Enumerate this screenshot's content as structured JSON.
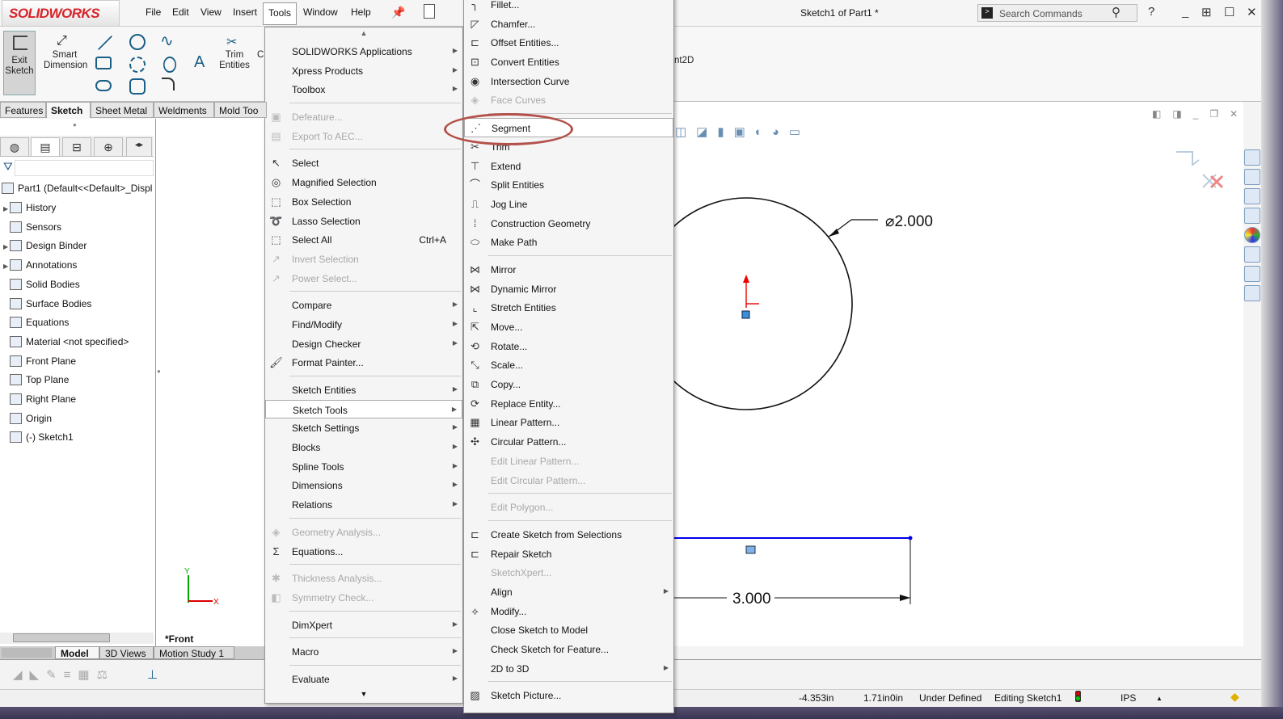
{
  "app": {
    "brand": "SOLIDWORKS",
    "doc_title": "Sketch1 of Part1 *",
    "search_placeholder": "Search Commands"
  },
  "menubar": [
    "File",
    "Edit",
    "View",
    "Insert",
    "Tools",
    "Window",
    "Help"
  ],
  "ribbon": {
    "exit_sketch": "Exit Sketch",
    "smart_dimension": "Smart Dimension",
    "trim_entities": "Trim Entities",
    "partial_c": "C",
    "partial_e": "E",
    "partial_nt2d": "nt2D"
  },
  "command_tabs": [
    "Features",
    "Sketch",
    "Sheet Metal",
    "Weldments",
    "Mold Too"
  ],
  "tree": {
    "root": "Part1  (Default<<Default>_Displ",
    "items": [
      {
        "label": "History",
        "exp": true
      },
      {
        "label": "Sensors",
        "exp": false
      },
      {
        "label": "Design Binder",
        "exp": true
      },
      {
        "label": "Annotations",
        "exp": true
      },
      {
        "label": "Solid Bodies",
        "exp": false
      },
      {
        "label": "Surface Bodies",
        "exp": false
      },
      {
        "label": "Equations",
        "exp": false
      },
      {
        "label": "Material <not specified>",
        "exp": false
      },
      {
        "label": "Front Plane",
        "exp": false
      },
      {
        "label": "Top Plane",
        "exp": false
      },
      {
        "label": "Right Plane",
        "exp": false
      },
      {
        "label": "Origin",
        "exp": false
      },
      {
        "label": "(-) Sketch1",
        "exp": false
      }
    ]
  },
  "bottom_tabs": [
    "Model",
    "3D Views",
    "Motion Study 1"
  ],
  "view_label": "*Front",
  "triad": {
    "x": "X",
    "y": "Y"
  },
  "sketch": {
    "circle_dim": "⌀2.000",
    "line_dim": "3.000"
  },
  "tools_menu": [
    {
      "label": "SOLIDWORKS Applications",
      "sub": true
    },
    {
      "label": "Xpress Products",
      "sub": true
    },
    {
      "label": "Toolbox",
      "sub": true
    },
    {
      "sep": true
    },
    {
      "label": "Defeature...",
      "dis": true,
      "icon": "▣"
    },
    {
      "label": "Export To AEC...",
      "dis": true,
      "icon": "▤"
    },
    {
      "sep": true
    },
    {
      "label": "Select",
      "icon": "↖"
    },
    {
      "label": "Magnified Selection",
      "icon": "◎"
    },
    {
      "label": "Box Selection",
      "icon": "⬚"
    },
    {
      "label": "Lasso Selection",
      "icon": "➰"
    },
    {
      "label": "Select All",
      "shortcut": "Ctrl+A",
      "icon": "⬚"
    },
    {
      "label": "Invert Selection",
      "dis": true,
      "icon": "↗"
    },
    {
      "label": "Power Select...",
      "dis": true,
      "icon": "↗"
    },
    {
      "sep": true
    },
    {
      "label": "Compare",
      "sub": true
    },
    {
      "label": "Find/Modify",
      "sub": true
    },
    {
      "label": "Design Checker",
      "sub": true
    },
    {
      "label": "Format Painter...",
      "icon": "🖌"
    },
    {
      "sep": true
    },
    {
      "label": "Sketch Entities",
      "sub": true
    },
    {
      "label": "Sketch Tools",
      "sub": true,
      "hl": true
    },
    {
      "label": "Sketch Settings",
      "sub": true
    },
    {
      "label": "Blocks",
      "sub": true
    },
    {
      "label": "Spline Tools",
      "sub": true
    },
    {
      "label": "Dimensions",
      "sub": true
    },
    {
      "label": "Relations",
      "sub": true
    },
    {
      "sep": true
    },
    {
      "label": "Geometry Analysis...",
      "dis": true,
      "icon": "◈"
    },
    {
      "label": "Equations...",
      "icon": "Σ"
    },
    {
      "sep": true
    },
    {
      "label": "Thickness Analysis...",
      "dis": true,
      "icon": "✱"
    },
    {
      "label": "Symmetry Check...",
      "dis": true,
      "icon": "◧"
    },
    {
      "sep": true
    },
    {
      "label": "DimXpert",
      "sub": true
    },
    {
      "sep": true
    },
    {
      "label": "Macro",
      "sub": true
    },
    {
      "sep": true
    },
    {
      "label": "Evaluate",
      "sub": true
    }
  ],
  "sketch_tools_menu": [
    {
      "label": "Fillet...",
      "icon": "╮"
    },
    {
      "label": "Chamfer...",
      "icon": "◸"
    },
    {
      "label": "Offset Entities...",
      "icon": "⊏"
    },
    {
      "label": "Convert Entities",
      "icon": "⊡"
    },
    {
      "label": "Intersection Curve",
      "icon": "◉"
    },
    {
      "label": "Face Curves",
      "dis": true,
      "icon": "◈"
    },
    {
      "sep": true
    },
    {
      "label": "Segment",
      "hl": true,
      "icon": "⋰"
    },
    {
      "label": "Trim",
      "icon": "✂"
    },
    {
      "label": "Extend",
      "icon": "⊤"
    },
    {
      "label": "Split Entities",
      "icon": "⌒"
    },
    {
      "label": "Jog Line",
      "icon": "⎍"
    },
    {
      "label": "Construction Geometry",
      "icon": "⁞"
    },
    {
      "label": "Make Path",
      "icon": "⬭"
    },
    {
      "sep": true
    },
    {
      "label": "Mirror",
      "icon": "⋈"
    },
    {
      "label": "Dynamic Mirror",
      "icon": "⋈"
    },
    {
      "label": "Stretch Entities",
      "icon": "⌞"
    },
    {
      "label": "Move...",
      "icon": "⇱"
    },
    {
      "label": "Rotate...",
      "icon": "⟲"
    },
    {
      "label": "Scale...",
      "icon": "⤡"
    },
    {
      "label": "Copy...",
      "icon": "⧉"
    },
    {
      "label": "Replace Entity...",
      "icon": "⟳"
    },
    {
      "label": "Linear Pattern...",
      "icon": "▦"
    },
    {
      "label": "Circular Pattern...",
      "icon": "✣"
    },
    {
      "label": "Edit Linear Pattern...",
      "dis": true
    },
    {
      "label": "Edit Circular Pattern...",
      "dis": true
    },
    {
      "sep": true
    },
    {
      "label": "Edit Polygon...",
      "dis": true
    },
    {
      "sep": true
    },
    {
      "label": "Create Sketch from Selections",
      "icon": "⊏"
    },
    {
      "label": "Repair Sketch",
      "icon": "⊏"
    },
    {
      "label": "SketchXpert...",
      "dis": true
    },
    {
      "label": "Align",
      "sub": true
    },
    {
      "label": "Modify...",
      "icon": "⟡"
    },
    {
      "label": "Close Sketch to Model"
    },
    {
      "label": "Check Sketch for Feature..."
    },
    {
      "label": "2D to 3D",
      "sub": true
    },
    {
      "sep": true
    },
    {
      "label": "Sketch Picture...",
      "icon": "▨"
    }
  ],
  "status": {
    "x": "-4.353in",
    "y": "1.71in",
    "z": "0in",
    "state": "Under Defined",
    "editing": "Editing Sketch1",
    "units": "IPS"
  },
  "colors": {
    "brand_red": "#d8232a",
    "highlight_ellipse": "#b3504a",
    "sketch_line_blue": "#0000ee"
  }
}
